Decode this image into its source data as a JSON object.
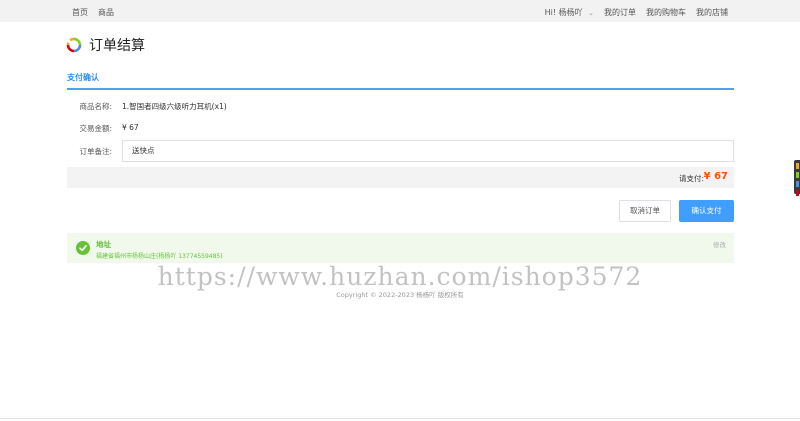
{
  "topbar": {
    "left_links": [
      "首页",
      "商品"
    ],
    "greeting": "Hi!",
    "username": "杨杨吖",
    "right_links": [
      "我的订单",
      "我的购物车",
      "我的店铺"
    ]
  },
  "page": {
    "title": "订单结算",
    "section_title": "支付确认"
  },
  "order": {
    "product_label": "商品名称:",
    "product_value": "1.智国者四级六级听力耳机(x1)",
    "amount_label": "交易金额:",
    "amount_value": "¥ 67",
    "remark_label": "订单备注:",
    "remark_value": "送快点"
  },
  "payment": {
    "pay_label": "请支付:",
    "pay_amount": "¥ 67",
    "accent_color": "#ff5000"
  },
  "buttons": {
    "cancel_label": "取消订单",
    "confirm_label": "确认支付",
    "confirm_color": "#409eff"
  },
  "address": {
    "title": "地址",
    "detail": "福建省福州市杨杨山庄(杨杨吖 13774559485)",
    "edit_label": "修改",
    "status_color": "#67c23a",
    "icon": "check-circle-icon"
  },
  "footer": {
    "watermark": "https://www.huzhan.com/ishop3572",
    "copyright": "Copyright © 2022-2023 杨杨吖 版权所有"
  }
}
